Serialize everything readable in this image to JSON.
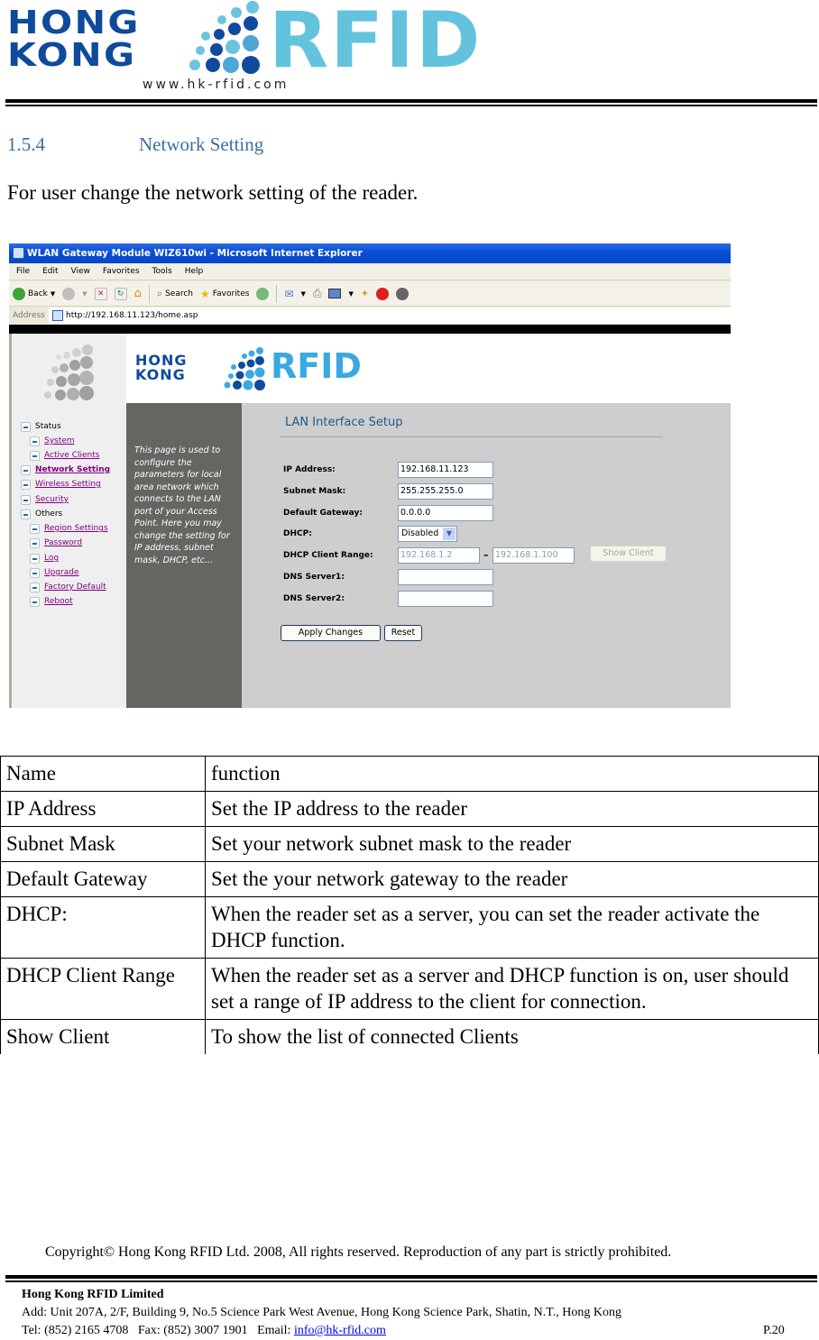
{
  "header": {
    "logo_top": "HONG",
    "logo_bottom": "KONG",
    "logo_brand": "RFID",
    "logo_url": "www.hk-rfid.com"
  },
  "section": {
    "number": "1.5.4",
    "title": "Network Setting",
    "intro": "For user change the network setting of the reader."
  },
  "browser": {
    "window_title": "WLAN Gateway Module WIZ610wi - Microsoft Internet Explorer",
    "menu": [
      "File",
      "Edit",
      "View",
      "Favorites",
      "Tools",
      "Help"
    ],
    "toolbar": {
      "back": "Back",
      "search": "Search",
      "favorites": "Favorites"
    },
    "address_label": "Address",
    "address_url": "http://192.168.11.123/home.asp"
  },
  "webpage": {
    "brand_top": "HONG",
    "brand_bottom": "KONG",
    "brand_rfid": "RFID",
    "nav": [
      {
        "label": "Status",
        "link": false,
        "bold": false,
        "level": 0
      },
      {
        "label": "System",
        "link": true,
        "bold": false,
        "level": 1
      },
      {
        "label": "Active Clients",
        "link": true,
        "bold": false,
        "level": 1
      },
      {
        "label": "Network Setting",
        "link": true,
        "bold": true,
        "level": 0
      },
      {
        "label": "Wireless Setting",
        "link": true,
        "bold": false,
        "level": 0
      },
      {
        "label": "Security",
        "link": true,
        "bold": false,
        "level": 0
      },
      {
        "label": "Others",
        "link": false,
        "bold": false,
        "level": 0
      },
      {
        "label": "Region Settings",
        "link": true,
        "bold": false,
        "level": 1
      },
      {
        "label": "Password",
        "link": true,
        "bold": false,
        "level": 1
      },
      {
        "label": "Log",
        "link": true,
        "bold": false,
        "level": 1
      },
      {
        "label": "Upgrade",
        "link": true,
        "bold": false,
        "level": 1
      },
      {
        "label": "Factory Default",
        "link": true,
        "bold": false,
        "level": 1
      },
      {
        "label": "Reboot",
        "link": true,
        "bold": false,
        "level": 1
      }
    ],
    "description": "This page is used to configure the parameters for local area network which connects to the LAN port of your Access Point. Here you may change the setting for IP address, subnet mask, DHCP, etc...",
    "form_title": "LAN Interface Setup",
    "fields": {
      "ip_label": "IP Address:",
      "ip_value": "192.168.11.123",
      "mask_label": "Subnet Mask:",
      "mask_value": "255.255.255.0",
      "gw_label": "Default Gateway:",
      "gw_value": "0.0.0.0",
      "dhcp_label": "DHCP:",
      "dhcp_value": "Disabled",
      "range_label": "DHCP Client Range:",
      "range_start": "192.168.1.2",
      "range_sep": "–",
      "range_end": "192.168.1.100",
      "show_client": "Show Client",
      "dns1_label": "DNS Server1:",
      "dns1_value": "",
      "dns2_label": "DNS Server2:",
      "dns2_value": ""
    },
    "apply_label": "Apply Changes",
    "reset_label": "Reset"
  },
  "table": {
    "header": [
      "Name",
      "function"
    ],
    "rows": [
      [
        "IP Address",
        "Set the IP address to the reader"
      ],
      [
        "Subnet Mask",
        "Set your network subnet mask to the reader"
      ],
      [
        "Default Gateway",
        "Set the your network gateway to the reader"
      ],
      [
        "DHCP:",
        "When the reader set as a server, you can set the reader activate the DHCP function."
      ],
      [
        "DHCP Client Range",
        "When the reader set as a server and DHCP function is on, user should set a range of IP address to the client for connection."
      ],
      [
        "Show Client",
        "To show the list of connected Clients"
      ]
    ]
  },
  "footer": {
    "copyright": "Copyright© Hong Kong RFID Ltd. 2008, All rights reserved. Reproduction of any part is strictly prohibited.",
    "company": "Hong Kong RFID Limited",
    "address": "Add: Unit 207A, 2/F, Building 9, No.5 Science Park West Avenue, Hong Kong Science Park, Shatin, N.T., Hong Kong",
    "tel_fax": "Tel: (852) 2165 4708   Fax: (852) 3007 1901   Email: ",
    "email": "info@hk-rfid.com",
    "page": "P.20"
  },
  "colors": {
    "brand_blue": "#0f4a9c",
    "brand_cyan": "#63c3dd",
    "heading": "#3b6ea5",
    "nav_link": "#800080"
  }
}
